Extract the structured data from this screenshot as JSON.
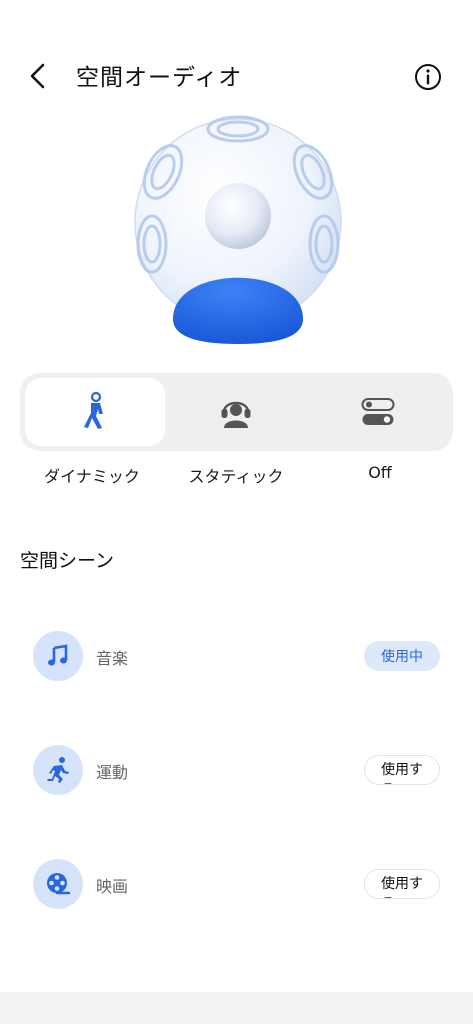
{
  "header": {
    "title": "空間オーディオ",
    "back_icon": "chevron-left-icon",
    "info_icon": "info-circle-icon"
  },
  "modes": {
    "items": [
      {
        "label": "ダイナミック",
        "icon": "walking-person-icon",
        "active": true
      },
      {
        "label": "スタティック",
        "icon": "headset-person-icon",
        "active": false
      },
      {
        "label": "Off",
        "icon": "toggle-switches-icon",
        "active": false
      }
    ]
  },
  "scenes": {
    "title": "空間シーン",
    "items": [
      {
        "label": "音楽",
        "icon": "music-note-icon",
        "status": "使用中"
      },
      {
        "label": "運動",
        "icon": "running-icon",
        "status": "使用す\nる"
      },
      {
        "label": "映画",
        "icon": "film-reel-icon",
        "status": "使用す\nる"
      }
    ]
  },
  "colors": {
    "accent": "#2a66e0",
    "icon_bg": "#d6e4fb",
    "track_bg": "#efefef"
  }
}
